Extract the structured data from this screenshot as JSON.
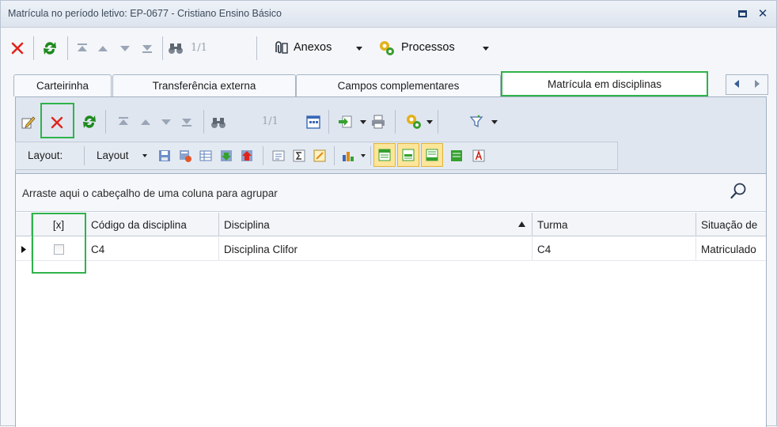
{
  "window": {
    "title": "Matrícula no período letivo: EP-0677 - Cristiano Ensino Básico"
  },
  "main_toolbar": {
    "page_count": "1/1",
    "anexos_label": "Anexos",
    "processos_label": "Processos"
  },
  "tabs": [
    {
      "label": "Carteirinha",
      "active": false
    },
    {
      "label": "Transferência externa",
      "active": false
    },
    {
      "label": "Campos complementares",
      "active": false
    },
    {
      "label": "Matrícula em disciplinas",
      "active": true
    }
  ],
  "inner_toolbar": {
    "page_count": "1/1"
  },
  "layout_toolbar": {
    "layout_caption": "Layout:",
    "layout_menu": "Layout"
  },
  "grid": {
    "group_hint": "Arraste aqui o cabeçalho de uma coluna para agrupar",
    "columns": [
      "[x]",
      "Código da disciplina",
      "Disciplina",
      "Turma",
      "Situação de"
    ],
    "rows": [
      {
        "selected": false,
        "codigo": "C4",
        "disciplina": "Disciplina Clifor",
        "turma": "C4",
        "situacao": "Matriculado"
      }
    ]
  },
  "colors": {
    "highlight": "#2fb24a",
    "delete_red": "#e0241b",
    "refresh_green": "#1f8a1f"
  }
}
